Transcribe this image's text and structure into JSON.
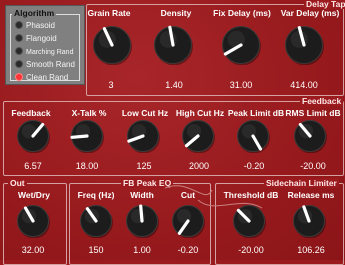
{
  "algorithm": {
    "title": "Algorithm",
    "options": [
      {
        "label": "Phasoid",
        "selected": false
      },
      {
        "label": "Flangoid",
        "selected": false
      },
      {
        "label": "Marching Rand",
        "selected": false
      },
      {
        "label": "Smooth Rand",
        "selected": false
      },
      {
        "label": "Clean Rand",
        "selected": true
      }
    ]
  },
  "delay_taps": {
    "title": "Delay Taps",
    "knobs": [
      {
        "label": "Grain Rate",
        "value": "3"
      },
      {
        "label": "Density",
        "value": "1.40"
      },
      {
        "label": "Fix Delay (ms)",
        "value": "31.00"
      },
      {
        "label": "Var Delay (ms)",
        "value": "414.00"
      }
    ]
  },
  "feedback": {
    "title": "Feedback",
    "knobs": [
      {
        "label": "Feedback",
        "value": "6.57"
      },
      {
        "label": "X-Talk %",
        "value": "18.00"
      },
      {
        "label": "Low Cut Hz",
        "value": "125"
      },
      {
        "label": "High Cut Hz",
        "value": "2000"
      },
      {
        "label": "Peak Limit dB",
        "value": "-0.20"
      },
      {
        "label": "RMS Limit dB",
        "value": "-20.00"
      }
    ]
  },
  "out": {
    "title": "Out",
    "knobs": [
      {
        "label": "Wet/Dry",
        "value": "32.00"
      }
    ]
  },
  "fb_peak_eq": {
    "title": "FB Peak EQ",
    "knobs": [
      {
        "label": "Freq (Hz)",
        "value": "150"
      },
      {
        "label": "Width",
        "value": "1.00"
      },
      {
        "label": "Cut",
        "value": "-0.20"
      }
    ]
  },
  "sidechain_limiter": {
    "title": "Sidechain Limiter",
    "knobs": [
      {
        "label": "Threshold dB",
        "value": "-20.00"
      },
      {
        "label": "Release ms",
        "value": "106.26"
      }
    ]
  },
  "colors": {
    "background": "#9a1a1e",
    "knob_body": "#1a1a1a",
    "indicator": "#ffffff",
    "radio_on": "#ff3535"
  }
}
